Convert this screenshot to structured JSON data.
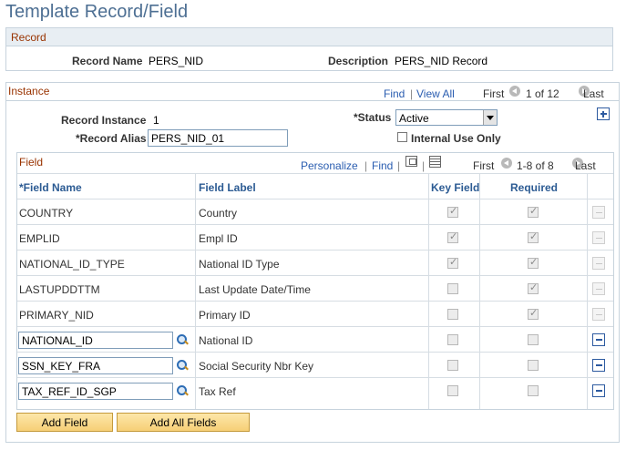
{
  "page": {
    "title": "Template Record/Field"
  },
  "record_box": {
    "header": "Record",
    "record_name_label": "Record Name",
    "record_name_value": "PERS_NID",
    "description_label": "Description",
    "description_value": "PERS_NID Record"
  },
  "instance_box": {
    "header": "Instance",
    "find_link": "Find",
    "view_all_link": "View All",
    "first_label": "First",
    "range_text": "1 of 12",
    "last_label": "Last",
    "record_instance_label": "Record Instance",
    "record_instance_value": "1",
    "status_label": "*Status",
    "status_value": "Active",
    "record_alias_label": "*Record Alias",
    "record_alias_value": "PERS_NID_01",
    "internal_use_label": "Internal Use Only"
  },
  "field_grid": {
    "header": "Field",
    "personalize_link": "Personalize",
    "find_link": "Find",
    "first_label": "First",
    "range_text": "1-8 of 8",
    "last_label": "Last",
    "columns": [
      "*Field Name",
      "Field Label",
      "Key Field",
      "Required"
    ],
    "rows": [
      {
        "field_name": "COUNTRY",
        "field_label": "Country",
        "key_field": true,
        "required": true,
        "editable": false
      },
      {
        "field_name": "EMPLID",
        "field_label": "Empl ID",
        "key_field": true,
        "required": true,
        "editable": false
      },
      {
        "field_name": "NATIONAL_ID_TYPE",
        "field_label": "National ID Type",
        "key_field": true,
        "required": true,
        "editable": false
      },
      {
        "field_name": "LASTUPDDTTM",
        "field_label": "Last Update Date/Time",
        "key_field": false,
        "required": true,
        "editable": false
      },
      {
        "field_name": "PRIMARY_NID",
        "field_label": "Primary ID",
        "key_field": false,
        "required": true,
        "editable": false
      },
      {
        "field_name": "NATIONAL_ID",
        "field_label": "National ID",
        "key_field": false,
        "required": false,
        "editable": true
      },
      {
        "field_name": "SSN_KEY_FRA",
        "field_label": "Social Security Nbr Key",
        "key_field": false,
        "required": false,
        "editable": true
      },
      {
        "field_name": "TAX_REF_ID_SGP",
        "field_label": "Tax Ref",
        "key_field": false,
        "required": false,
        "editable": true
      }
    ]
  },
  "buttons": {
    "add_field": "Add Field",
    "add_all_fields": "Add All Fields"
  },
  "icons": {
    "lookup": "lookup-icon",
    "zoom": "zoom-icon",
    "grid_download": "download-grid-icon",
    "add_row": "plus-icon",
    "delete_row": "minus-icon"
  },
  "colors": {
    "title": "#4d6f93",
    "section_header": "#993300",
    "link": "#2a5db0",
    "button": "#f6cf76"
  }
}
